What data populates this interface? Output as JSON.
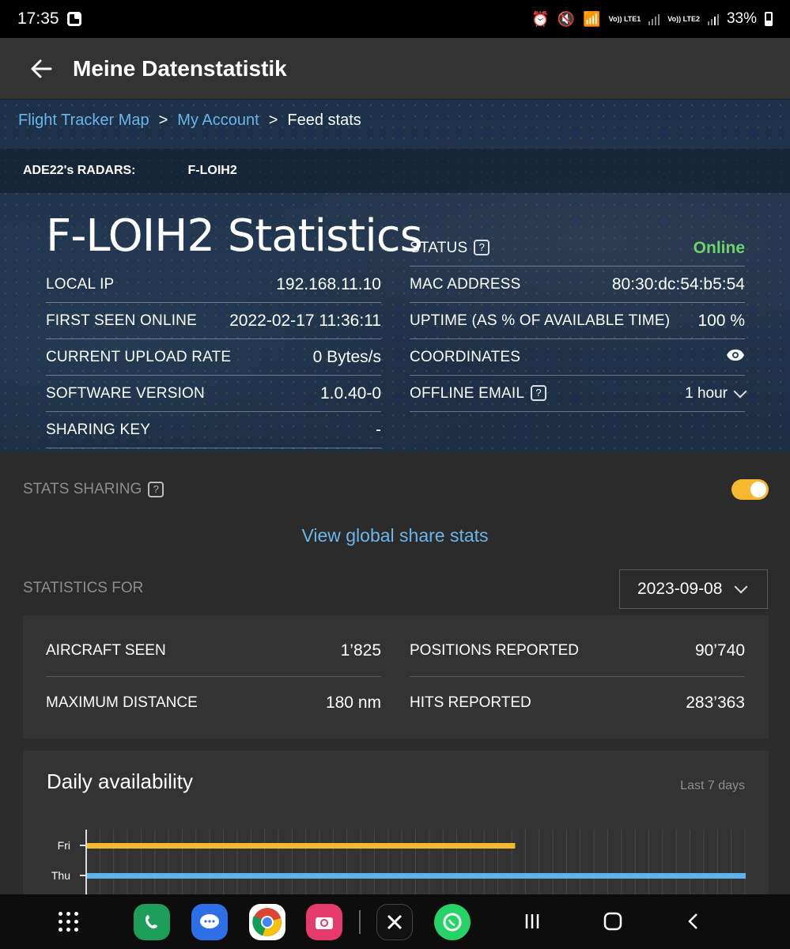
{
  "status_bar": {
    "time": "17:35",
    "lte1": "Vo)) LTE1",
    "lte2": "Vo)) LTE2",
    "battery": "33%"
  },
  "appbar": {
    "title": "Meine Datenstatistik"
  },
  "breadcrumb": {
    "items": [
      "Flight Tracker Map",
      "My Account",
      "Feed stats"
    ],
    "separator": ">"
  },
  "radars": {
    "label": "ADE22's RADARS:",
    "name": "F-LOIH2"
  },
  "stats_title": "F-LOIH2 Statistics",
  "left_rows": [
    {
      "label": "LOCAL IP",
      "value": "192.168.11.10"
    },
    {
      "label": "FIRST SEEN ONLINE",
      "value": "2022-02-17 11:36:11"
    },
    {
      "label": "CURRENT UPLOAD RATE",
      "value": "0 Bytes/s"
    },
    {
      "label": "SOFTWARE VERSION",
      "value": "1.0.40-0"
    },
    {
      "label": "SHARING KEY",
      "value": "-"
    }
  ],
  "right_rows": {
    "status_label": "STATUS",
    "status_value": "Online",
    "mac_label": "MAC ADDRESS",
    "mac_value": "80:30:dc:54:b5:54",
    "uptime_label": "UPTIME (AS % OF AVAILABLE TIME)",
    "uptime_value": "100 %",
    "coordinates_label": "COORDINATES",
    "offline_label": "OFFLINE EMAIL",
    "offline_value": "1 hour",
    "help_glyph": "?"
  },
  "sharing": {
    "label": "STATS SHARING",
    "enabled": true
  },
  "global_link": "View global share stats",
  "statistics_for": {
    "label": "STATISTICS FOR",
    "date": "2023-09-08"
  },
  "stats": {
    "aircraft_label": "AIRCRAFT SEEN",
    "aircraft_value": "1’825",
    "maxdist_label": "MAXIMUM DISTANCE",
    "maxdist_value": "180 nm",
    "positions_label": "POSITIONS REPORTED",
    "positions_value": "90’740",
    "hits_label": "HITS REPORTED",
    "hits_value": "283’363"
  },
  "daily": {
    "title": "Daily availability",
    "range": "Last 7 days"
  },
  "chart_data": {
    "type": "bar",
    "orientation": "horizontal",
    "categories": [
      "Fri",
      "Thu"
    ],
    "values": [
      0.65,
      1.0
    ],
    "colors": [
      "#f5b82e",
      "#5bb4ec"
    ],
    "xlim": [
      0,
      1
    ],
    "grid": true
  },
  "colors": {
    "accent_yellow": "#f5b82e",
    "link_blue": "#6ab6ea",
    "online_green": "#6dd46d"
  },
  "navbar_apps": [
    "grid-menu-icon",
    "phone-icon",
    "messages-icon",
    "chrome-icon",
    "camera-icon",
    "x-icon",
    "whatsapp-icon"
  ]
}
